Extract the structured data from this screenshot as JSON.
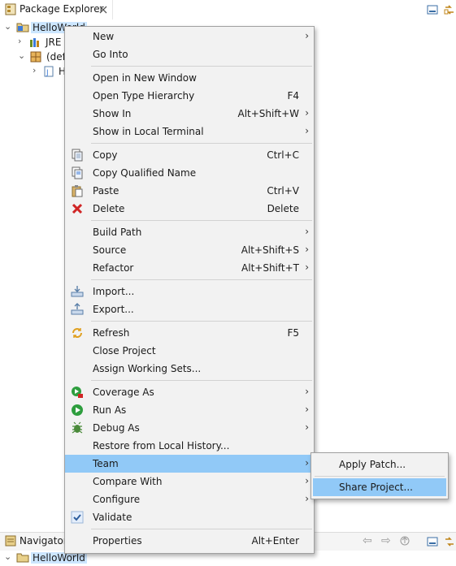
{
  "package_explorer": {
    "title": "Package Explorer",
    "close": "☒",
    "tree": {
      "project": "HelloWorld",
      "jre": "JRE",
      "package": "(defa",
      "file": "H"
    }
  },
  "context_menu": {
    "groups": [
      [
        {
          "label": "New",
          "shortcut": "",
          "submenu": true,
          "icon": ""
        },
        {
          "label": "Go Into",
          "shortcut": "",
          "submenu": false,
          "icon": ""
        }
      ],
      [
        {
          "label": "Open in New Window",
          "shortcut": "",
          "submenu": false,
          "icon": ""
        },
        {
          "label": "Open Type Hierarchy",
          "shortcut": "F4",
          "submenu": false,
          "icon": ""
        },
        {
          "label": "Show In",
          "shortcut": "Alt+Shift+W",
          "submenu": true,
          "icon": ""
        },
        {
          "label": "Show in Local Terminal",
          "shortcut": "",
          "submenu": true,
          "icon": ""
        }
      ],
      [
        {
          "label": "Copy",
          "shortcut": "Ctrl+C",
          "submenu": false,
          "icon": "copy-icon"
        },
        {
          "label": "Copy Qualified Name",
          "shortcut": "",
          "submenu": false,
          "icon": "copy-qualified-icon"
        },
        {
          "label": "Paste",
          "shortcut": "Ctrl+V",
          "submenu": false,
          "icon": "paste-icon"
        },
        {
          "label": "Delete",
          "shortcut": "Delete",
          "submenu": false,
          "icon": "delete-icon"
        }
      ],
      [
        {
          "label": "Build Path",
          "shortcut": "",
          "submenu": true,
          "icon": ""
        },
        {
          "label": "Source",
          "shortcut": "Alt+Shift+S",
          "submenu": true,
          "icon": ""
        },
        {
          "label": "Refactor",
          "shortcut": "Alt+Shift+T",
          "submenu": true,
          "icon": ""
        }
      ],
      [
        {
          "label": "Import...",
          "shortcut": "",
          "submenu": false,
          "icon": "import-icon"
        },
        {
          "label": "Export...",
          "shortcut": "",
          "submenu": false,
          "icon": "export-icon"
        }
      ],
      [
        {
          "label": "Refresh",
          "shortcut": "F5",
          "submenu": false,
          "icon": "refresh-icon"
        },
        {
          "label": "Close Project",
          "shortcut": "",
          "submenu": false,
          "icon": ""
        },
        {
          "label": "Assign Working Sets...",
          "shortcut": "",
          "submenu": false,
          "icon": ""
        }
      ],
      [
        {
          "label": "Coverage As",
          "shortcut": "",
          "submenu": true,
          "icon": "coverage-icon"
        },
        {
          "label": "Run As",
          "shortcut": "",
          "submenu": true,
          "icon": "run-icon"
        },
        {
          "label": "Debug As",
          "shortcut": "",
          "submenu": true,
          "icon": "debug-icon"
        },
        {
          "label": "Restore from Local History...",
          "shortcut": "",
          "submenu": false,
          "icon": ""
        },
        {
          "label": "Team",
          "shortcut": "",
          "submenu": true,
          "icon": "",
          "highlighted": true
        },
        {
          "label": "Compare With",
          "shortcut": "",
          "submenu": true,
          "icon": ""
        },
        {
          "label": "Configure",
          "shortcut": "",
          "submenu": true,
          "icon": ""
        },
        {
          "label": "Validate",
          "shortcut": "",
          "submenu": false,
          "icon": "checkmark-icon"
        }
      ],
      [
        {
          "label": "Properties",
          "shortcut": "Alt+Enter",
          "submenu": false,
          "icon": ""
        }
      ]
    ]
  },
  "team_submenu": {
    "items": [
      {
        "label": "Apply Patch..."
      },
      {
        "label": "Share Project...",
        "highlighted": true
      }
    ]
  },
  "navigator": {
    "title": "Navigator",
    "project": "HelloWorld"
  },
  "colors": {
    "menu_bg": "#f2f2f2",
    "highlight": "#91c9f7",
    "tree_selection": "#cce6ff"
  }
}
